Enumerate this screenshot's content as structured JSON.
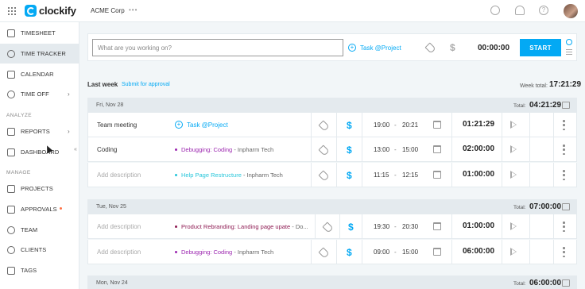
{
  "app": {
    "name": "clockify",
    "workspace": "ACME Corp",
    "more": "•••"
  },
  "colors": {
    "accent": "#03a9f4",
    "sidebar_active": "#e4eaee",
    "debugging": "#9c27b0",
    "help_page": "#26c6da",
    "rebranding": "#8e1b53",
    "approval_dot": "#ff7043"
  },
  "sidebar": {
    "items": [
      {
        "label": "TIMESHEET",
        "icon": "timesheet-icon"
      },
      {
        "label": "TIME TRACKER",
        "icon": "clock-icon",
        "active": true
      },
      {
        "label": "CALENDAR",
        "icon": "calendar-icon"
      },
      {
        "label": "TIME OFF",
        "icon": "time-off-icon",
        "chevron": "›"
      }
    ],
    "analyze_label": "ANALYZE",
    "analyze_items": [
      {
        "label": "REPORTS",
        "icon": "reports-icon",
        "chevron": "›"
      },
      {
        "label": "DASHBOARD",
        "icon": "dashboard-icon"
      }
    ],
    "manage_label": "MANAGE",
    "manage_items": [
      {
        "label": "PROJECTS",
        "icon": "projects-icon"
      },
      {
        "label": "APPROVALS",
        "icon": "approvals-icon"
      },
      {
        "label": "TEAM",
        "icon": "team-icon"
      },
      {
        "label": "CLIENTS",
        "icon": "clients-icon"
      },
      {
        "label": "TAGS",
        "icon": "tags-icon"
      }
    ],
    "collapse_glyph": "«"
  },
  "timer": {
    "placeholder": "What are you working on?",
    "project_label": "Task @Project",
    "time": "00:00:00",
    "start_label": "START"
  },
  "week": {
    "title": "Last week",
    "submit_label": "Submit for approval",
    "total_label": "Week total:",
    "total": "17:21:29"
  },
  "days": [
    {
      "date": "Fri, Nov 28",
      "total_label": "Total:",
      "total": "04:21:29",
      "entries": [
        {
          "description": "Team meeting",
          "project_add": "Task @Project",
          "start": "19:00",
          "dash": "-",
          "end": "20:21",
          "duration": "01:21:29"
        },
        {
          "description": "Coding",
          "project": "Debugging: Coding",
          "client": "- Inpharm Tech",
          "start": "13:00",
          "dash": "-",
          "end": "15:00",
          "duration": "02:00:00"
        },
        {
          "description": "Add description",
          "project": "Help Page Restructure",
          "client": "- Inpharm Tech",
          "start": "11:15",
          "dash": "-",
          "end": "12:15",
          "duration": "01:00:00"
        }
      ]
    },
    {
      "date": "Tue, Nov 25",
      "total_label": "Total:",
      "total": "07:00:00",
      "entries": [
        {
          "description": "Add description",
          "project": "Product Rebranding: Landing page upate",
          "client": "- Do...",
          "start": "19:30",
          "dash": "-",
          "end": "20:30",
          "duration": "01:00:00"
        },
        {
          "description": "Add description",
          "project": "Debugging: Coding",
          "client": "- Inpharm Tech",
          "start": "09:00",
          "dash": "-",
          "end": "15:00",
          "duration": "06:00:00"
        }
      ]
    },
    {
      "date": "Mon, Nov 24",
      "total_label": "Total:",
      "total": "06:00:00",
      "entries": []
    }
  ]
}
